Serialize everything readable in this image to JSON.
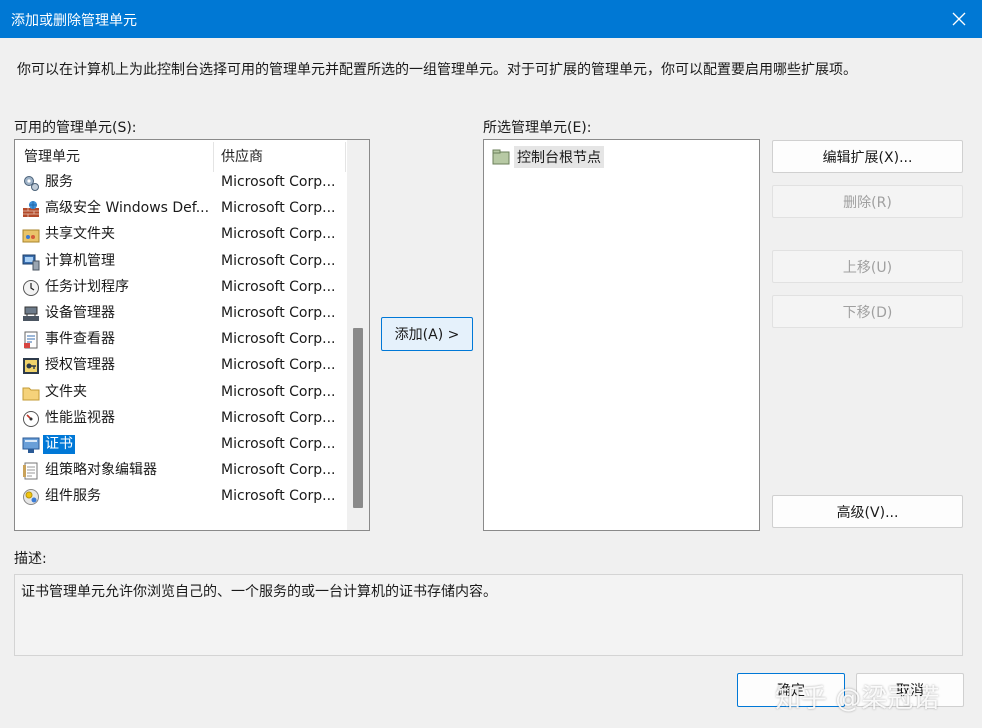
{
  "window": {
    "title": "添加或删除管理单元"
  },
  "intro": "你可以在计算机上为此控制台选择可用的管理单元并配置所选的一组管理单元。对于可扩展的管理单元，你可以配置要启用哪些扩展项。",
  "available": {
    "label": "可用的管理单元(S):",
    "col_snapin": "管理单元",
    "col_vendor": "供应商",
    "items": [
      {
        "name": "服务",
        "vendor": "Microsoft Corp...",
        "icon": "gears-icon"
      },
      {
        "name": "高级安全 Windows Def...",
        "vendor": "Microsoft Corp...",
        "icon": "firewall-icon"
      },
      {
        "name": "共享文件夹",
        "vendor": "Microsoft Corp...",
        "icon": "shared-folder-icon"
      },
      {
        "name": "计算机管理",
        "vendor": "Microsoft Corp...",
        "icon": "computer-management-icon"
      },
      {
        "name": "任务计划程序",
        "vendor": "Microsoft Corp...",
        "icon": "clock-icon"
      },
      {
        "name": "设备管理器",
        "vendor": "Microsoft Corp...",
        "icon": "device-manager-icon"
      },
      {
        "name": "事件查看器",
        "vendor": "Microsoft Corp...",
        "icon": "event-viewer-icon"
      },
      {
        "name": "授权管理器",
        "vendor": "Microsoft Corp...",
        "icon": "authorization-icon"
      },
      {
        "name": "文件夹",
        "vendor": "Microsoft Corp...",
        "icon": "folder-icon"
      },
      {
        "name": "性能监视器",
        "vendor": "Microsoft Corp...",
        "icon": "performance-icon"
      },
      {
        "name": "证书",
        "vendor": "Microsoft Corp...",
        "icon": "certificate-icon",
        "selected": true
      },
      {
        "name": "组策略对象编辑器",
        "vendor": "Microsoft Corp...",
        "icon": "policy-editor-icon"
      },
      {
        "name": "组件服务",
        "vendor": "Microsoft Corp...",
        "icon": "component-services-icon"
      }
    ]
  },
  "add_button": "添加(A) >",
  "selected": {
    "label": "所选管理单元(E):",
    "root": "控制台根节点"
  },
  "buttons": {
    "edit_ext": "编辑扩展(X)...",
    "remove": "删除(R)",
    "move_up": "上移(U)",
    "move_down": "下移(D)",
    "advanced": "高级(V)...",
    "ok": "确定",
    "cancel": "取消"
  },
  "description": {
    "label": "描述:",
    "text": "证书管理单元允许你浏览自己的、一个服务的或一台计算机的证书存储内容。"
  },
  "watermark": "知乎 @梁冠诺"
}
